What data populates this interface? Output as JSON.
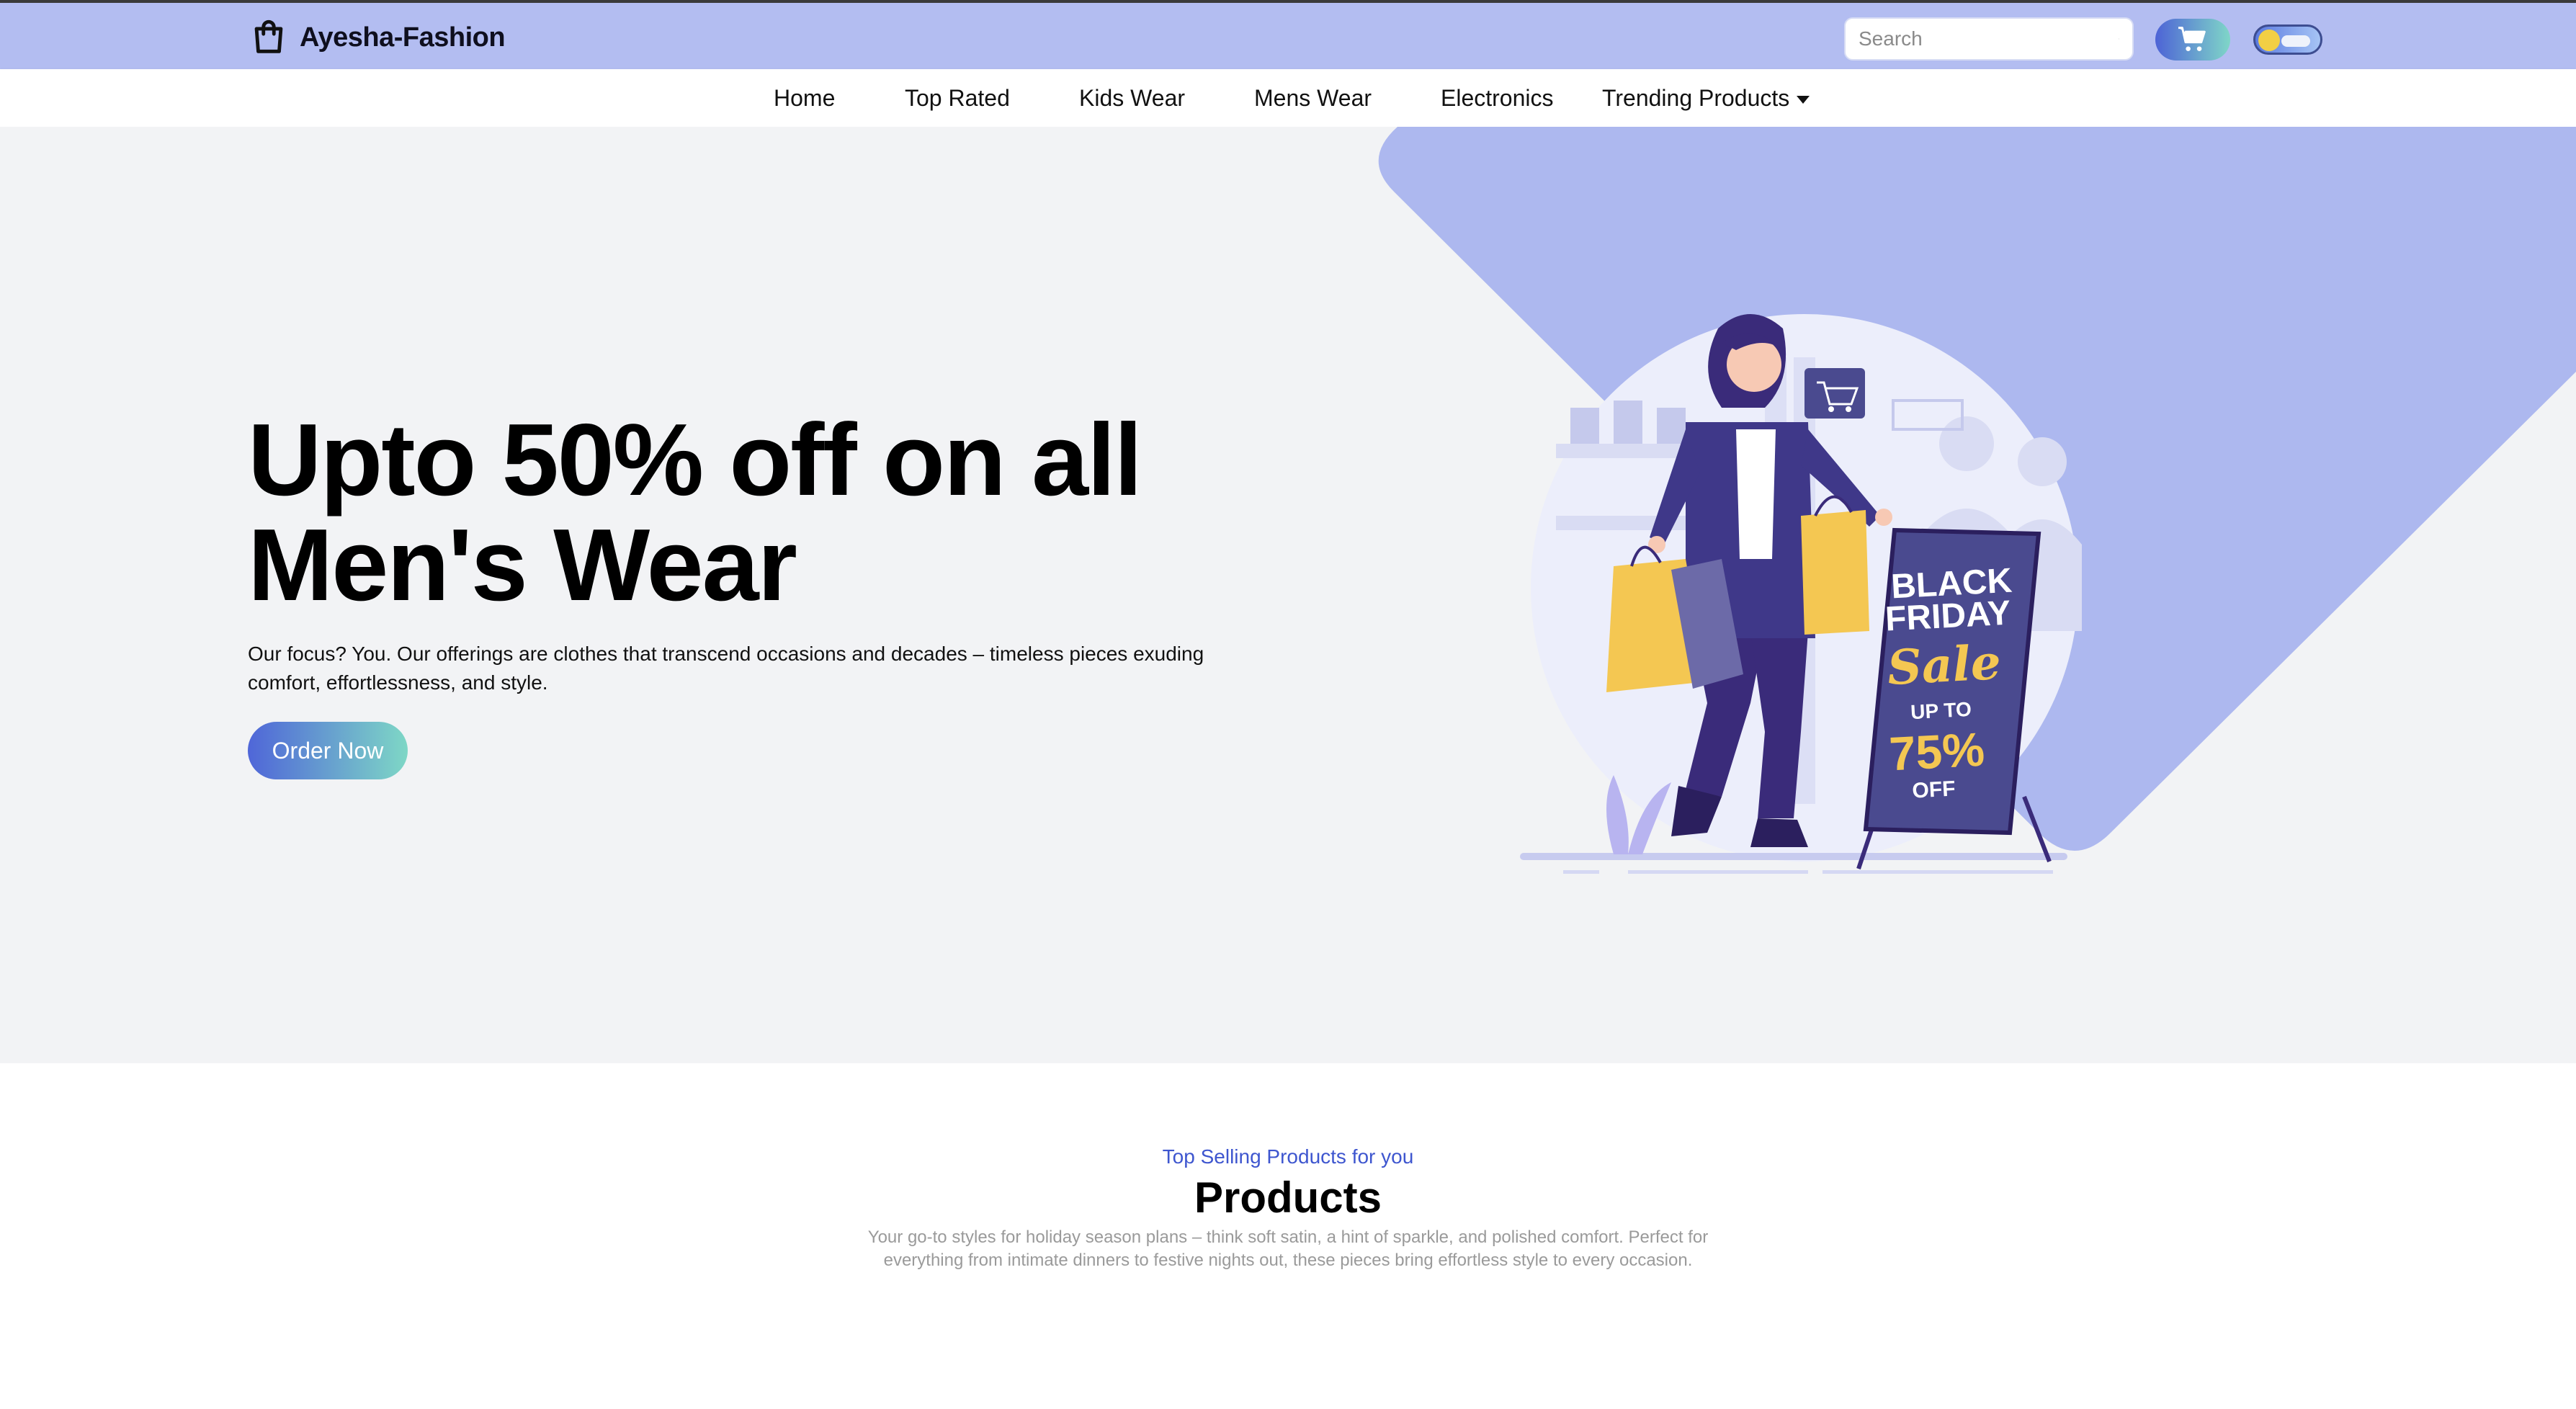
{
  "header": {
    "brand": "Ayesha-Fashion",
    "brand_icon": "shopping-bag-icon",
    "search_placeholder": "Search",
    "search_icon": "search-icon",
    "cart_icon": "cart-icon",
    "theme_toggle": "theme-toggle",
    "colors": {
      "topbar": "#b3bdf1",
      "accent_start": "#4d63d6",
      "accent_end": "#7fd6c8"
    }
  },
  "nav": {
    "items": [
      {
        "label": "Home"
      },
      {
        "label": "Top Rated"
      },
      {
        "label": "Kids Wear"
      },
      {
        "label": "Mens Wear"
      },
      {
        "label": "Electronics"
      },
      {
        "label": "Trending Products",
        "dropdown": true
      }
    ]
  },
  "hero": {
    "title": "Upto 50% off on all Men's Wear",
    "description": "Our focus? You. Our offerings are clothes that transcend occasions and decades – timeless pieces exuding comfort, effortlessness, and style.",
    "cta": "Order Now",
    "illustration": {
      "line1": "BLACK",
      "line2": "FRIDAY",
      "line3": "Sale",
      "line4": "UP TO",
      "line5": "75%",
      "line6": "OFF"
    },
    "colors": {
      "background": "#f2f3f5",
      "shape": "#adb8ef"
    }
  },
  "products_section": {
    "kicker": "Top Selling Products for you",
    "title": "Products",
    "description": "Your go-to styles for holiday season plans – think soft satin, a hint of sparkle, and polished comfort. Perfect for everything from intimate dinners to festive nights out, these pieces bring effortless style to every occasion."
  }
}
